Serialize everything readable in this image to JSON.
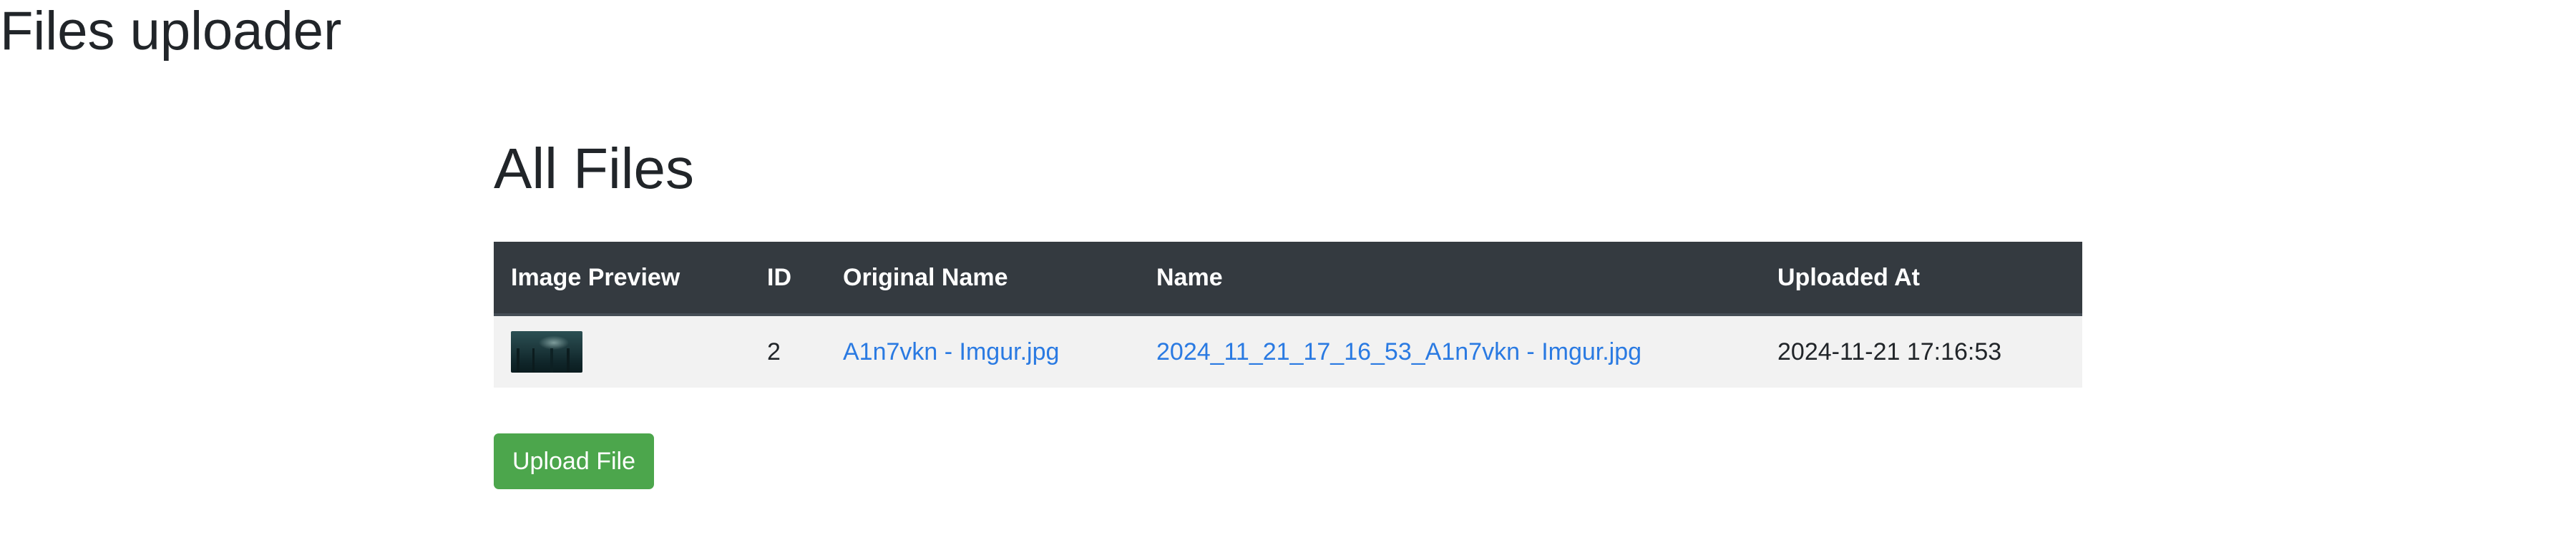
{
  "header": {
    "title": "Files uploader"
  },
  "main": {
    "title": "All Files",
    "table": {
      "columns": [
        "Image Preview",
        "ID",
        "Original Name",
        "Name",
        "Uploaded At"
      ],
      "rows": [
        {
          "preview_icon": "image-thumbnail",
          "id": "2",
          "original_name": "A1n7vkn - Imgur.jpg",
          "name": "2024_11_21_17_16_53_A1n7vkn - Imgur.jpg",
          "uploaded_at": "2024-11-21 17:16:53"
        }
      ]
    },
    "upload_button_label": "Upload File"
  },
  "colors": {
    "table_header_bg": "#343a40",
    "row_bg": "#f2f2f2",
    "link": "#2a7ae2",
    "upload_button": "#4ca64c"
  }
}
